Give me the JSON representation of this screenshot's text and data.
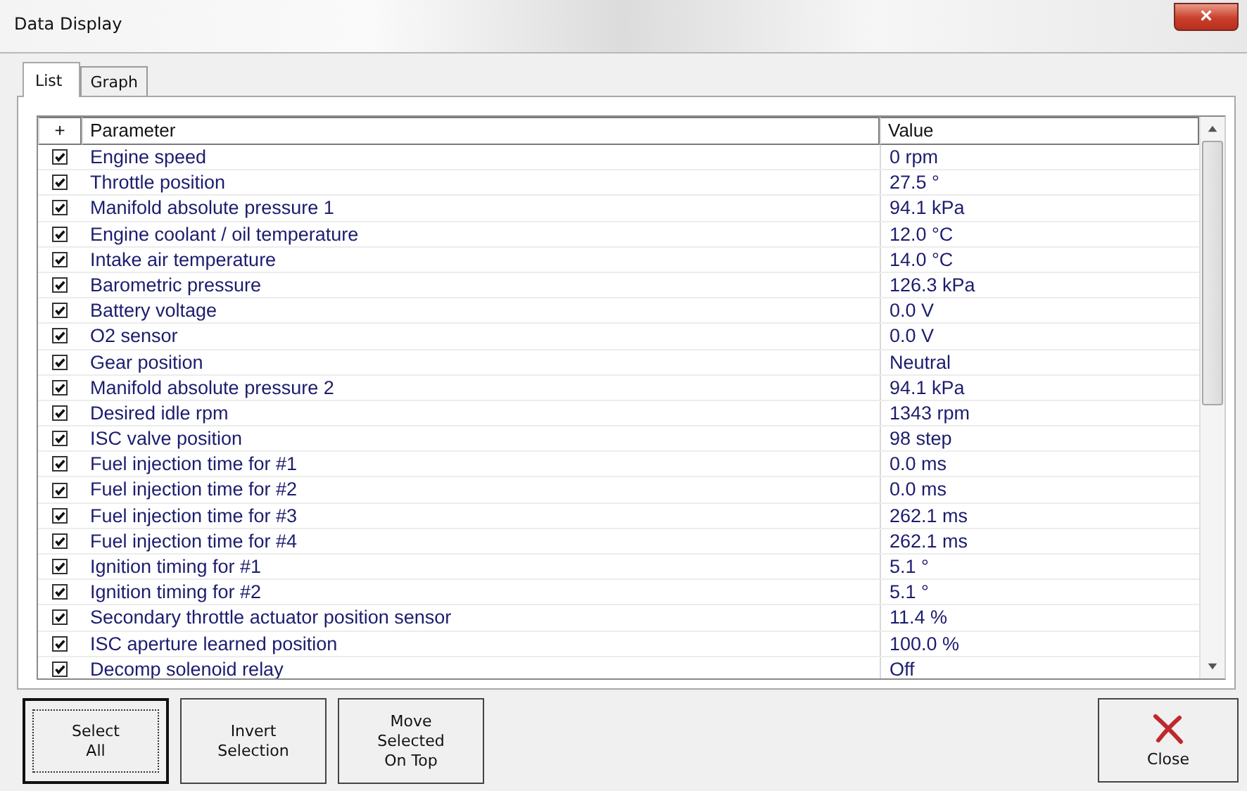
{
  "window": {
    "title": "Data Display",
    "close_label": "×"
  },
  "tabs": [
    {
      "label": "List",
      "selected": true
    },
    {
      "label": "Graph",
      "selected": false
    }
  ],
  "table": {
    "columns": [
      "+",
      "Parameter",
      "Value"
    ],
    "rows": [
      {
        "checked": true,
        "parameter": "Engine speed",
        "value": "0 rpm"
      },
      {
        "checked": true,
        "parameter": "Throttle position",
        "value": "27.5 °"
      },
      {
        "checked": true,
        "parameter": "Manifold absolute pressure 1",
        "value": "94.1 kPa"
      },
      {
        "checked": true,
        "parameter": "Engine coolant / oil temperature",
        "value": "12.0 °C"
      },
      {
        "checked": true,
        "parameter": "Intake air temperature",
        "value": "14.0 °C"
      },
      {
        "checked": true,
        "parameter": "Barometric pressure",
        "value": "126.3 kPa"
      },
      {
        "checked": true,
        "parameter": "Battery voltage",
        "value": "0.0 V"
      },
      {
        "checked": true,
        "parameter": "O2 sensor",
        "value": "0.0 V"
      },
      {
        "checked": true,
        "parameter": "Gear position",
        "value": "Neutral"
      },
      {
        "checked": true,
        "parameter": "Manifold absolute pressure 2",
        "value": "94.1 kPa"
      },
      {
        "checked": true,
        "parameter": "Desired idle rpm",
        "value": "1343 rpm"
      },
      {
        "checked": true,
        "parameter": "ISC valve position",
        "value": "98 step"
      },
      {
        "checked": true,
        "parameter": "Fuel injection time for #1",
        "value": "0.0 ms"
      },
      {
        "checked": true,
        "parameter": "Fuel injection time for #2",
        "value": "0.0 ms"
      },
      {
        "checked": true,
        "parameter": "Fuel injection time for #3",
        "value": "262.1 ms"
      },
      {
        "checked": true,
        "parameter": "Fuel injection time for #4",
        "value": "262.1 ms"
      },
      {
        "checked": true,
        "parameter": "Ignition timing for #1",
        "value": "5.1 °"
      },
      {
        "checked": true,
        "parameter": "Ignition timing for #2",
        "value": "5.1 °"
      },
      {
        "checked": true,
        "parameter": "Secondary throttle actuator position sensor",
        "value": "11.4 %"
      },
      {
        "checked": true,
        "parameter": "ISC aperture learned position",
        "value": "100.0 %"
      },
      {
        "checked": true,
        "parameter": "Decomp solenoid relay",
        "value": "Off"
      }
    ]
  },
  "buttons": [
    {
      "lines": [
        "Select",
        "All"
      ],
      "focused": true
    },
    {
      "lines": [
        "Invert",
        "Selection"
      ],
      "focused": false
    },
    {
      "lines": [
        "Move",
        "Selected",
        "On Top"
      ],
      "focused": false
    }
  ],
  "close_button": {
    "label": "Close"
  }
}
